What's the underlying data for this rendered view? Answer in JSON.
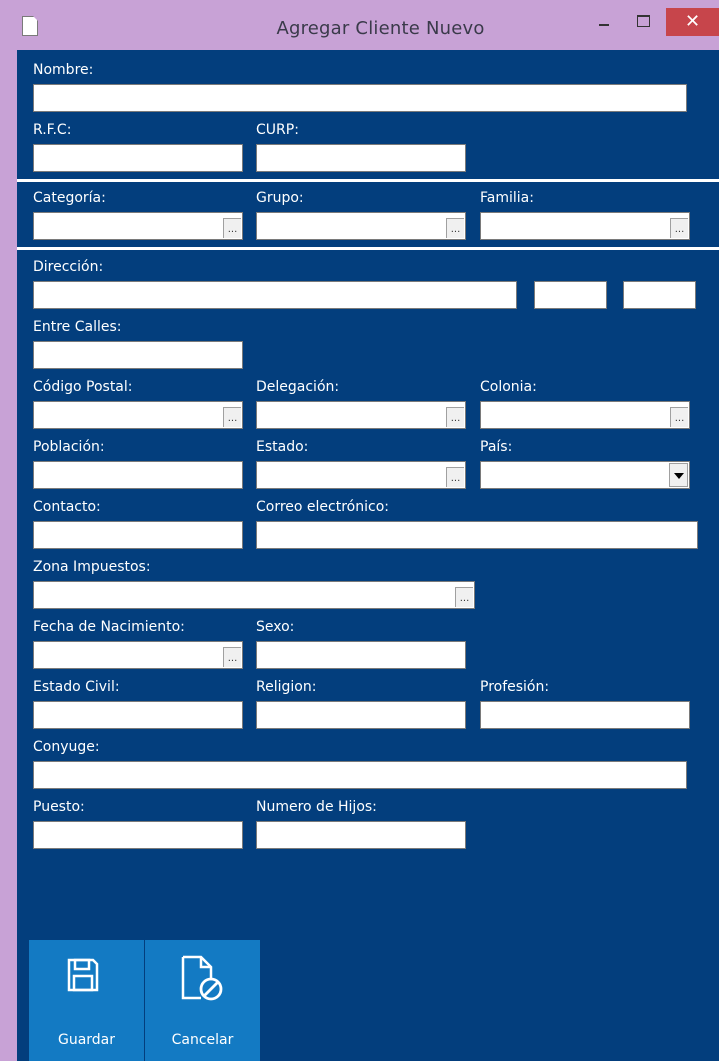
{
  "window": {
    "title": "Agregar Cliente Nuevo",
    "close_glyph": "✕"
  },
  "form": {
    "nombre": {
      "label": "Nombre:",
      "value": ""
    },
    "rfc": {
      "label": "R.F.C:",
      "value": ""
    },
    "curp": {
      "label": "CURP:",
      "value": ""
    },
    "categoria": {
      "label": "Categoría:",
      "value": ""
    },
    "grupo": {
      "label": "Grupo:",
      "value": ""
    },
    "familia": {
      "label": "Familia:",
      "value": ""
    },
    "direccion": {
      "label": "Dirección:",
      "value": ""
    },
    "entre_calles": {
      "label": "Entre Calles:",
      "value": ""
    },
    "codigo_postal": {
      "label": "Código Postal:",
      "value": ""
    },
    "delegacion": {
      "label": "Delegación:",
      "value": ""
    },
    "colonia": {
      "label": "Colonia:",
      "value": ""
    },
    "poblacion": {
      "label": "Población:",
      "value": ""
    },
    "estado": {
      "label": "Estado:",
      "value": ""
    },
    "pais": {
      "label": "País:",
      "value": ""
    },
    "contacto": {
      "label": "Contacto:",
      "value": ""
    },
    "correo": {
      "label": "Correo electrónico:",
      "value": ""
    },
    "zona_impuestos": {
      "label": "Zona Impuestos:",
      "value": ""
    },
    "fecha_nacimiento": {
      "label": "Fecha de Nacimiento:",
      "value": ""
    },
    "sexo": {
      "label": "Sexo:",
      "value": ""
    },
    "estado_civil": {
      "label": "Estado Civil:",
      "value": ""
    },
    "religion": {
      "label": "Religion:",
      "value": ""
    },
    "profesion": {
      "label": "Profesión:",
      "value": ""
    },
    "conyuge": {
      "label": "Conyuge:",
      "value": ""
    },
    "puesto": {
      "label": "Puesto:",
      "value": ""
    },
    "numero_hijos": {
      "label": "Numero de Hijos:",
      "value": ""
    }
  },
  "lookup_glyph": "...",
  "toolbar": {
    "save_label": "Guardar",
    "cancel_label": "Cancelar"
  },
  "colors": {
    "form_background": "#033e7d",
    "title_bar": "#c8a2d6",
    "close_button": "#c7454b",
    "toolbar_button": "#137ac3"
  },
  "icons": {
    "app": "document-icon",
    "save": "floppy-disk-icon",
    "cancel": "document-cancel-icon"
  }
}
